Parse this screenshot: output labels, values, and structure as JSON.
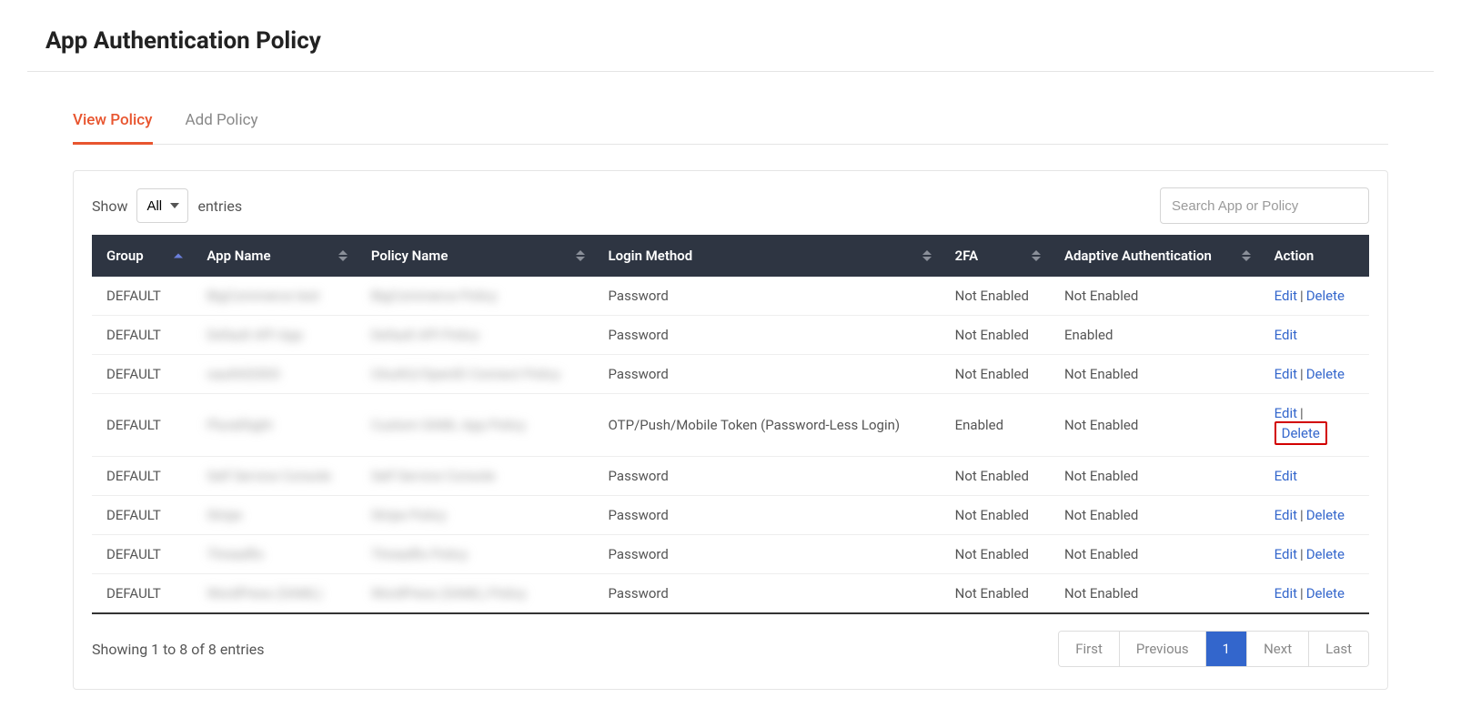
{
  "title": "App Authentication Policy",
  "tabs": {
    "view": "View Policy",
    "add": "Add Policy"
  },
  "controls": {
    "show_label": "Show",
    "entries_label": "entries",
    "select_value": "All",
    "search_placeholder": "Search App or Policy"
  },
  "columns": {
    "group": "Group",
    "app": "App Name",
    "policy": "Policy Name",
    "login": "Login Method",
    "twofa": "2FA",
    "adaptive": "Adaptive Authentication",
    "action": "Action"
  },
  "rows": [
    {
      "group": "DEFAULT",
      "app": "BigCommerce test",
      "policy": "BigCommerce Policy",
      "login": "Password",
      "twofa": "Not Enabled",
      "adaptive": "Not Enabled",
      "actions": [
        "Edit",
        "Delete"
      ],
      "highlight_delete": false
    },
    {
      "group": "DEFAULT",
      "app": "Default API App",
      "policy": "Default API Policy",
      "login": "Password",
      "twofa": "Not Enabled",
      "adaptive": "Enabled",
      "actions": [
        "Edit"
      ],
      "highlight_delete": false
    },
    {
      "group": "DEFAULT",
      "app": "oauth02003",
      "policy": "OAuth2/OpenID Connect Policy",
      "login": "Password",
      "twofa": "Not Enabled",
      "adaptive": "Not Enabled",
      "actions": [
        "Edit",
        "Delete"
      ],
      "highlight_delete": false
    },
    {
      "group": "DEFAULT",
      "app": "PluralSight",
      "policy": "Custom SAML App Policy",
      "login": "OTP/Push/Mobile Token (Password-Less Login)",
      "twofa": "Enabled",
      "adaptive": "Not Enabled",
      "actions": [
        "Edit",
        "Delete"
      ],
      "highlight_delete": true
    },
    {
      "group": "DEFAULT",
      "app": "Self Service Console",
      "policy": "Self Service Console",
      "login": "Password",
      "twofa": "Not Enabled",
      "adaptive": "Not Enabled",
      "actions": [
        "Edit"
      ],
      "highlight_delete": false
    },
    {
      "group": "DEFAULT",
      "app": "Stripe",
      "policy": "Stripe Policy",
      "login": "Password",
      "twofa": "Not Enabled",
      "adaptive": "Not Enabled",
      "actions": [
        "Edit",
        "Delete"
      ],
      "highlight_delete": false
    },
    {
      "group": "DEFAULT",
      "app": "Threadfix",
      "policy": "Threadfix Policy",
      "login": "Password",
      "twofa": "Not Enabled",
      "adaptive": "Not Enabled",
      "actions": [
        "Edit",
        "Delete"
      ],
      "highlight_delete": false
    },
    {
      "group": "DEFAULT",
      "app": "WordPress (SAML)",
      "policy": "WordPress (SAML) Policy",
      "login": "Password",
      "twofa": "Not Enabled",
      "adaptive": "Not Enabled",
      "actions": [
        "Edit",
        "Delete"
      ],
      "highlight_delete": false
    }
  ],
  "info": "Showing 1 to 8 of 8 entries",
  "pager": {
    "first": "First",
    "prev": "Previous",
    "page": "1",
    "next": "Next",
    "last": "Last"
  },
  "action_labels": {
    "edit": "Edit",
    "delete": "Delete"
  }
}
